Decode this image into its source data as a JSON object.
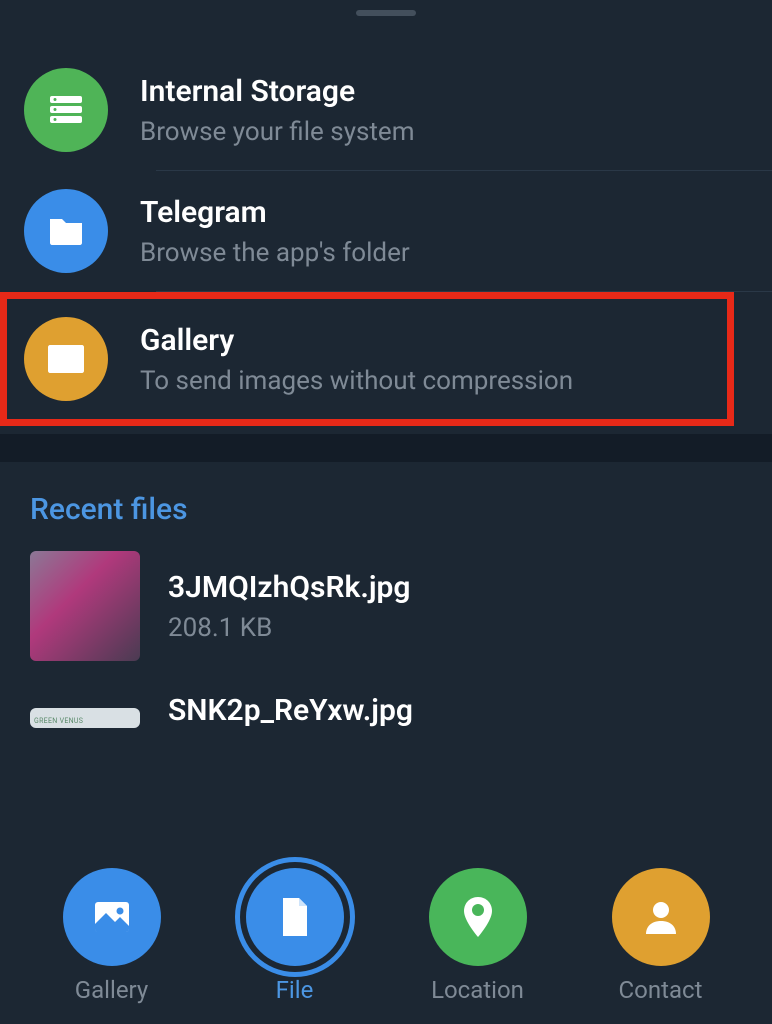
{
  "storage_options": [
    {
      "title": "Internal Storage",
      "subtitle": "Browse your file system",
      "icon": "storage-icon",
      "color": "green"
    },
    {
      "title": "Telegram",
      "subtitle": "Browse the app's folder",
      "icon": "folder-icon",
      "color": "blue"
    },
    {
      "title": "Gallery",
      "subtitle": "To send images without compression",
      "icon": "image-icon",
      "color": "gold",
      "highlighted": true
    }
  ],
  "recent": {
    "heading": "Recent files",
    "files": [
      {
        "name": "3JMQIzhQsRk.jpg",
        "size": "208.1 KB"
      },
      {
        "name": "SNK2p_ReYxw.jpg",
        "size": ""
      }
    ]
  },
  "nav": {
    "gallery": "Gallery",
    "file": "File",
    "location": "Location",
    "contact": "Contact"
  },
  "colors": {
    "background": "#1c2733",
    "green": "#4fb457",
    "blue": "#3a8de8",
    "gold": "#dfa030",
    "nav_green": "#49b65a",
    "highlight_border": "#e72918",
    "text_primary": "#ffffff",
    "text_secondary": "#7f8a96",
    "accent": "#4c96e2"
  }
}
